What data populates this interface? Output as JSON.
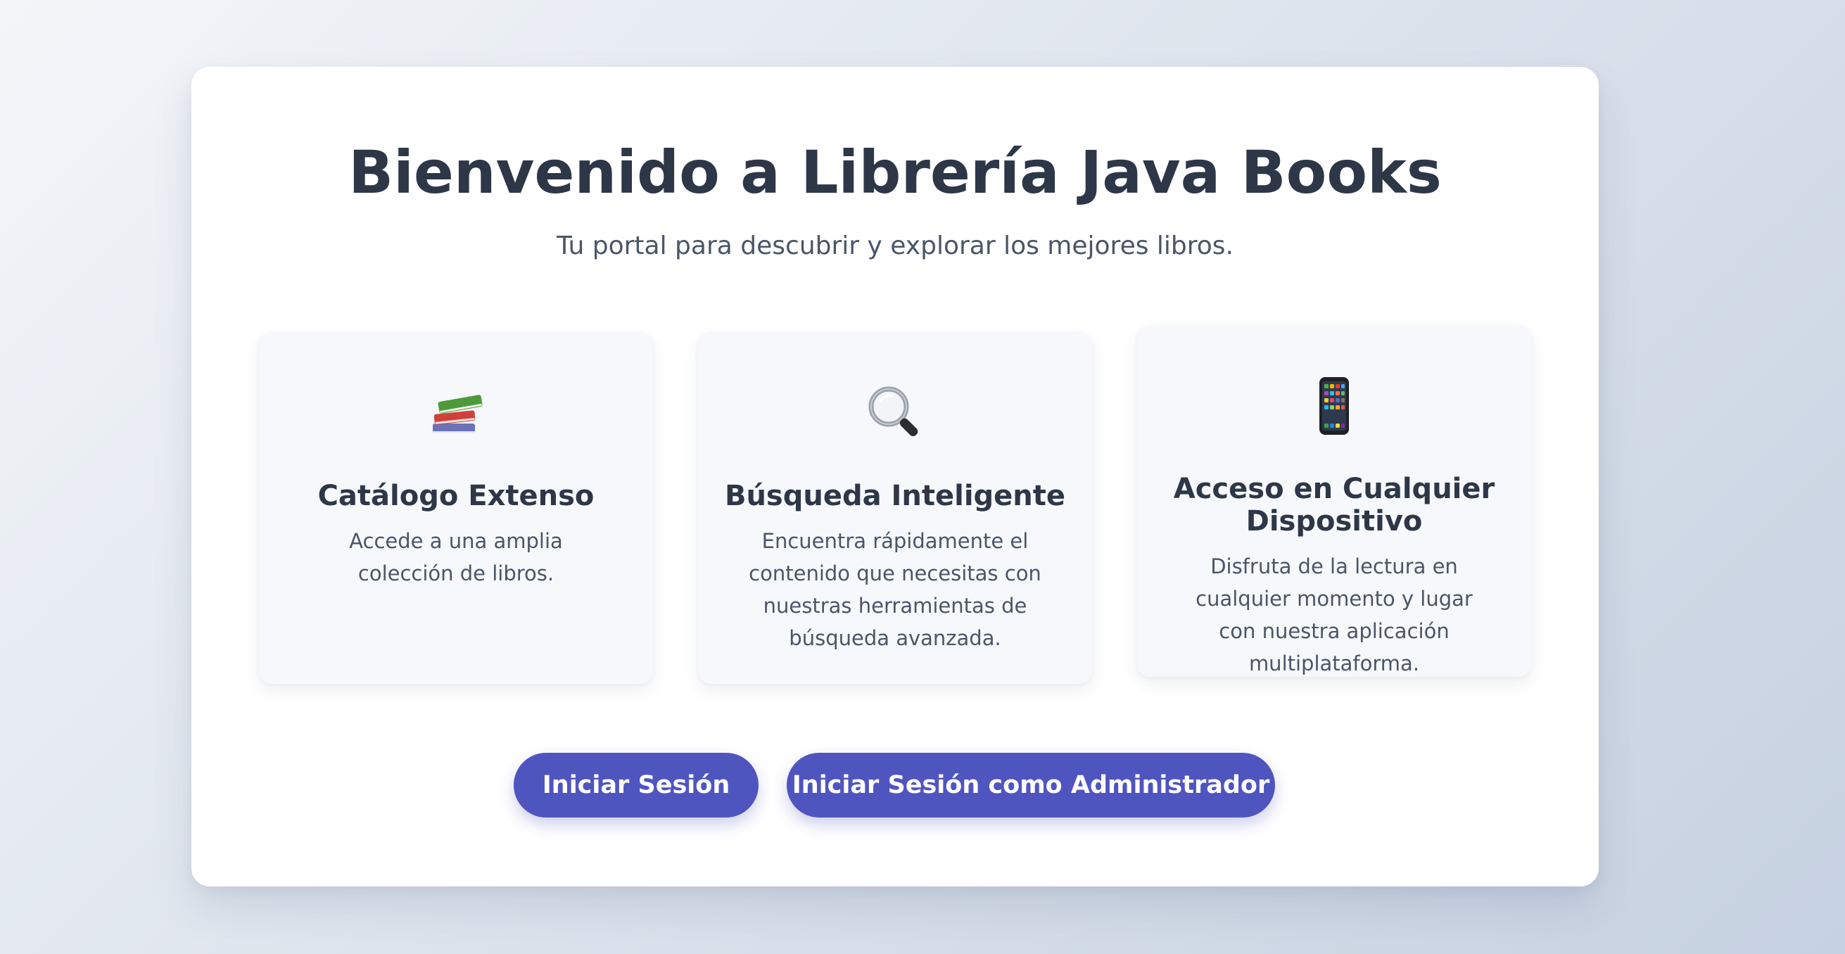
{
  "hero": {
    "title": "Bienvenido a Librería Java Books",
    "subtitle": "Tu portal para descubrir y explorar los mejores libros."
  },
  "features": [
    {
      "icon": "books-icon",
      "title": "Catálogo Extenso",
      "description": "Accede a una amplia colección de libros."
    },
    {
      "icon": "magnifier-icon",
      "title": "Búsqueda Inteligente",
      "description": "Encuentra rápidamente el contenido que necesitas con nuestras herramientas de búsqueda avanzada."
    },
    {
      "icon": "smartphone-icon",
      "title": "Acceso en Cualquier Dispositivo",
      "description": "Disfruta de la lectura en cualquier momento y lugar con nuestra aplicación multiplataforma."
    }
  ],
  "actions": {
    "login_label": "Iniciar Sesión",
    "admin_login_label": "Iniciar Sesión como Administrador"
  },
  "colors": {
    "primary_button": "#4f55bf",
    "heading": "#2d3748",
    "body_text": "#4a5568",
    "card_background": "#f6f8fb"
  }
}
